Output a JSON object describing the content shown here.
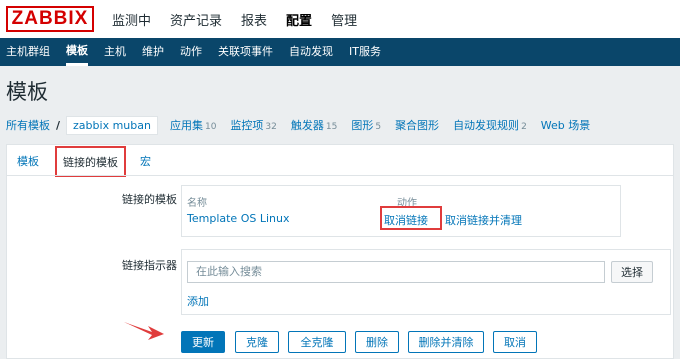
{
  "logo": "ZABBIX",
  "main_menu": [
    "监测中",
    "资产记录",
    "报表",
    "配置",
    "管理"
  ],
  "sub_menu": [
    "主机群组",
    "模板",
    "主机",
    "维护",
    "动作",
    "关联项事件",
    "自动发现",
    "IT服务"
  ],
  "page_title": "模板",
  "breadcrumb": {
    "all_templates": "所有模板",
    "separator": "/",
    "current": "zabbix muban",
    "items": [
      {
        "label": "应用集",
        "count": "10"
      },
      {
        "label": "监控项",
        "count": "32"
      },
      {
        "label": "触发器",
        "count": "15"
      },
      {
        "label": "图形",
        "count": "5"
      },
      {
        "label": "聚合图形",
        "count": ""
      },
      {
        "label": "自动发现规则",
        "count": "2"
      },
      {
        "label": "Web 场景",
        "count": ""
      }
    ]
  },
  "tabs": [
    "模板",
    "链接的模板",
    "宏"
  ],
  "linked_templates": {
    "label": "链接的模板",
    "col_name": "名称",
    "col_action": "动作",
    "rows": [
      {
        "name": "Template OS Linux",
        "unlink": "取消链接",
        "unlink_clear": "取消链接并清理"
      }
    ]
  },
  "link_indicator": {
    "label": "链接指示器",
    "placeholder": "在此输入搜索",
    "select_button": "选择",
    "add_link": "添加"
  },
  "buttons": {
    "update": "更新",
    "clone": "克隆",
    "full_clone": "全克隆",
    "delete": "删除",
    "delete_clear": "删除并清除",
    "cancel": "取消"
  },
  "colors": {
    "brand": "#d40000",
    "nav_bg": "#0a466a",
    "link": "#0275b8",
    "highlight": "#e03c3c"
  }
}
